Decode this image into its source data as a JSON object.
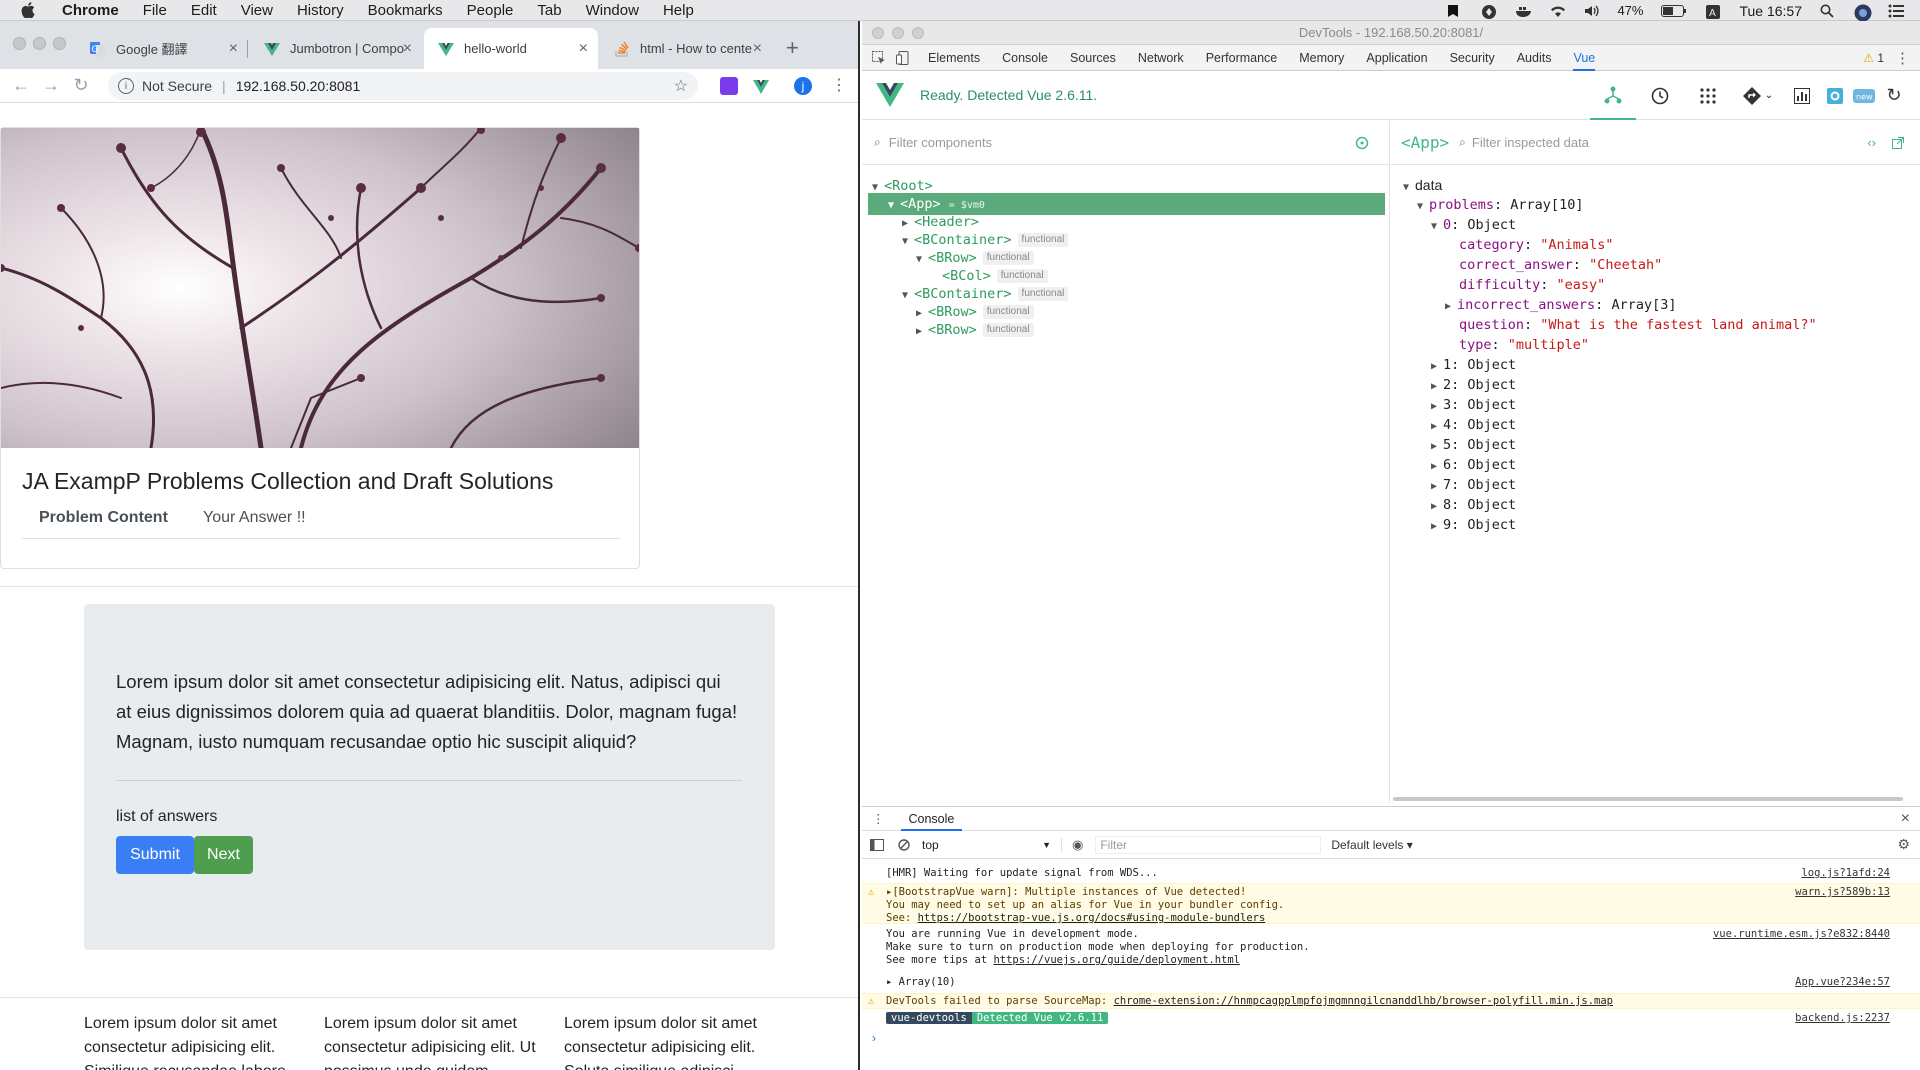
{
  "menubar": {
    "app": "Chrome",
    "items": [
      "File",
      "Edit",
      "View",
      "History",
      "Bookmarks",
      "People",
      "Tab",
      "Window",
      "Help"
    ],
    "battery": "47%",
    "clock": "Tue 16:57"
  },
  "browser": {
    "tabs": [
      {
        "title": "Google 翻譯"
      },
      {
        "title": "Jumbotron | Compo"
      },
      {
        "title": "hello-world"
      },
      {
        "title": "html - How to cente"
      }
    ],
    "security": "Not Secure",
    "url": "192.168.50.20:8081"
  },
  "page": {
    "card_title": "JA ExampP Problems Collection and Draft Solutions",
    "tabs": [
      "Problem Content",
      "Your Answer !!"
    ],
    "lead": "Lorem ipsum dolor sit amet consectetur adipisicing elit. Natus, adipisci qui at eius dignissimos dolorem quia ad quaerat blanditiis. Dolor, magnam fuga! Magnam, iusto numquam recusandae optio hic suscipit aliquid?",
    "answers_label": "list of answers",
    "submit": "Submit",
    "next": "Next",
    "columns": [
      "Lorem ipsum dolor sit amet consectetur adipisicing elit. Similique recusandae labore",
      "Lorem ipsum dolor sit amet consectetur adipisicing elit. Ut possimus unde quidem",
      "Lorem ipsum dolor sit amet consectetur adipisicing elit. Soluta similique adipisci"
    ],
    "colors": {
      "primary": "#3a7ef5",
      "success": "#4f9d4f"
    }
  },
  "devtools": {
    "title": "DevTools - 192.168.50.20:8081/",
    "tabs": [
      "Elements",
      "Console",
      "Sources",
      "Network",
      "Performance",
      "Memory",
      "Application",
      "Security",
      "Audits",
      "Vue"
    ],
    "warning_count": "1",
    "ready": "Ready. Detected Vue 2.6.11.",
    "filter_components": "Filter components",
    "inspected": "<App>",
    "filter_data": "Filter inspected data",
    "tree": {
      "root": "<Root>",
      "app": "<App>",
      "app_ref": "= $vm0",
      "header": "<Header>",
      "bcontainer": "<BContainer>",
      "brow": "<BRow>",
      "bcol": "<BCol>",
      "functional": "functional"
    },
    "data": {
      "section": "data",
      "problems_key": "problems",
      "problems_val": "Array[10]",
      "item0_key": "0",
      "item0_val": "Object",
      "category": "\"Animals\"",
      "correct_answer": "\"Cheetah\"",
      "difficulty": "\"easy\"",
      "incorrect_answers": "Array[3]",
      "question": "\"What is the fastest  land animal?\"",
      "type": "\"multiple\"",
      "objects": [
        "1: Object",
        "2: Object",
        "3: Object",
        "4: Object",
        "5: Object",
        "6: Object",
        "7: Object",
        "8: Object",
        "9: Object"
      ]
    },
    "console": {
      "tab": "Console",
      "context": "top",
      "filter": "Filter",
      "levels": "Default levels ▾",
      "lines": {
        "hmr": "[HMR] Waiting for update signal from WDS...",
        "hmr_src": "log.js?1afd:24",
        "bv1": "[BootstrapVue warn]: Multiple instances of Vue detected!",
        "bv2": "You may need to set up an alias for Vue in your bundler config.",
        "bv3": "See: ",
        "bv3_link": "https://bootstrap-vue.js.org/docs#using-module-bundlers",
        "bv_src": "warn.js?589b:13",
        "dev1": "You are running Vue in development mode.",
        "dev2": "Make sure to turn on production mode when deploying for production.",
        "dev3": "See more tips at ",
        "dev3_link": "https://vuejs.org/guide/deployment.html",
        "dev_src": "vue.runtime.esm.js?e832:8440",
        "arr": "Array(10)",
        "arr_src": "App.vue?234e:57",
        "sm": "DevTools failed to parse SourceMap: ",
        "sm_link": "chrome-extension://hnmpcagpplmpfojmgmnngilcnanddlhb/browser-polyfill.min.js.map",
        "vd1": "vue-devtools",
        "vd2": "Detected Vue v2.6.11",
        "vd_src": "backend.js:2237"
      }
    }
  }
}
